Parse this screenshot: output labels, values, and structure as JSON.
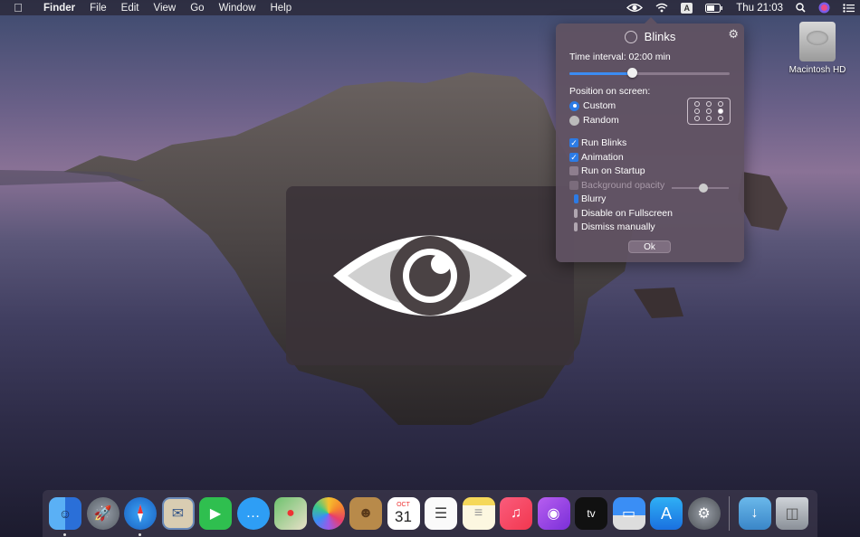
{
  "menubar": {
    "app_name": "Finder",
    "menus": [
      "File",
      "Edit",
      "View",
      "Go",
      "Window",
      "Help"
    ],
    "input_source": "A",
    "clock": "Thu 21:03"
  },
  "desktop": {
    "hd_label": "Macintosh HD"
  },
  "panel": {
    "title": "Blinks",
    "interval_label": "Time interval: 02:00 min",
    "interval_fraction": 0.39,
    "position_label": "Position on screen:",
    "radio_custom": "Custom",
    "radio_random": "Random",
    "selected_position": "Custom",
    "grid_selected_cell": "middle-right",
    "checkboxes": {
      "run_blinks": {
        "label": "Run Blinks",
        "checked": true
      },
      "animation": {
        "label": "Animation",
        "checked": true
      },
      "run_on_startup": {
        "label": "Run on Startup",
        "checked": false
      },
      "background_opacity": {
        "label": "Background opacity",
        "checked": false,
        "disabled": true,
        "value_fraction": 0.55
      },
      "blurry": {
        "label": "Blurry",
        "checked": true
      },
      "disable_on_fullscreen": {
        "label": "Disable on Fullscreen",
        "checked": false
      },
      "dismiss_manually": {
        "label": "Dismiss manually",
        "checked": false
      }
    },
    "ok_label": "Ok"
  },
  "dock": {
    "apps": [
      "Finder",
      "Launchpad",
      "Safari",
      "Mail",
      "FaceTime",
      "Messages",
      "Maps",
      "Photos",
      "Contacts",
      "Calendar",
      "Reminders",
      "Notes",
      "Music",
      "Podcasts",
      "TV",
      "Keynote",
      "App Store",
      "System Preferences"
    ],
    "calendar_month": "OCT",
    "calendar_day": "31",
    "tv_label": "tv",
    "right_items": [
      "Downloads",
      "Trash"
    ]
  },
  "colors": {
    "accent": "#2c7be5",
    "panel_bg": "#605262",
    "overlay_bg": "#3a3238"
  }
}
